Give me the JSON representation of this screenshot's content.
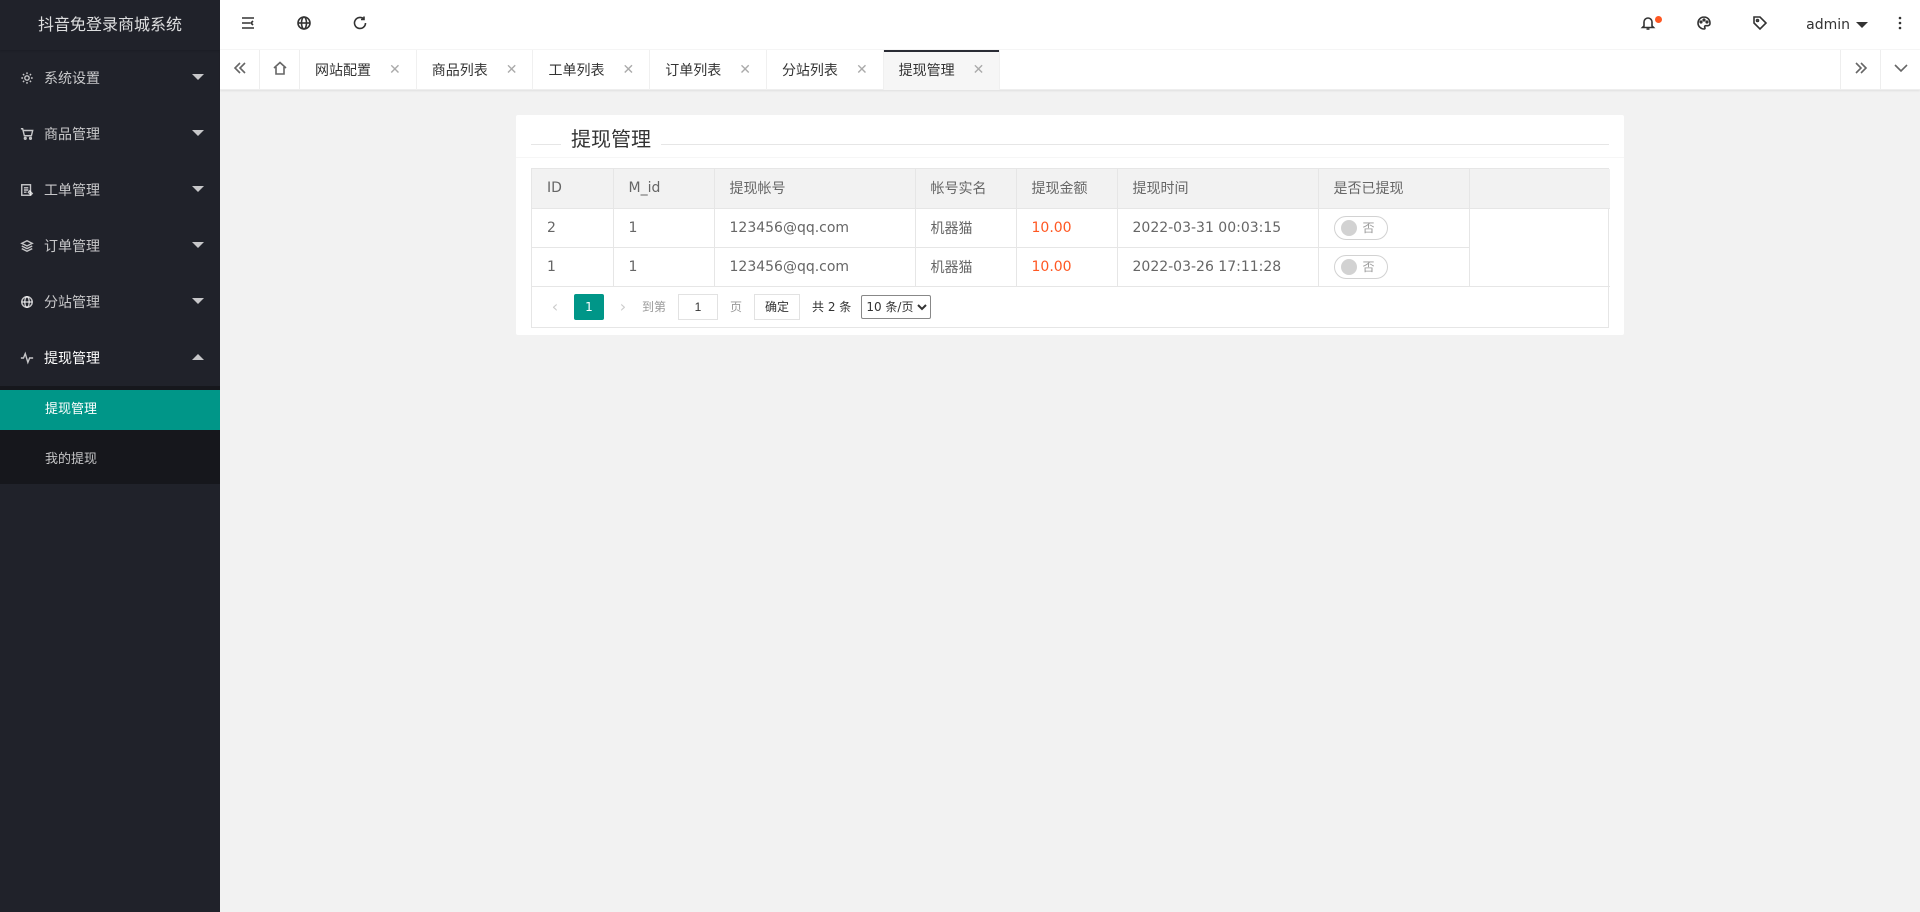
{
  "app": {
    "title": "抖音免登录商城系统"
  },
  "sidebar": {
    "items": [
      {
        "label": "系统设置",
        "icon": "gear-icon"
      },
      {
        "label": "商品管理",
        "icon": "cart-icon"
      },
      {
        "label": "工单管理",
        "icon": "ticket-icon"
      },
      {
        "label": "订单管理",
        "icon": "layers-icon"
      },
      {
        "label": "分站管理",
        "icon": "globe-icon"
      },
      {
        "label": "提现管理",
        "icon": "pulse-icon"
      }
    ],
    "subitems": [
      {
        "label": "提现管理"
      },
      {
        "label": "我的提现"
      }
    ]
  },
  "header": {
    "user": "admin",
    "icons": [
      "menu-fold-icon",
      "globe-icon",
      "refresh-icon",
      "bell-icon",
      "palette-icon",
      "tag-icon",
      "more-vertical-icon"
    ],
    "notification_color": "#ff5722"
  },
  "tabs": [
    {
      "label": "网站配置"
    },
    {
      "label": "商品列表"
    },
    {
      "label": "工单列表"
    },
    {
      "label": "订单列表"
    },
    {
      "label": "分站列表"
    },
    {
      "label": "提现管理"
    }
  ],
  "card": {
    "title": "提现管理",
    "columns": [
      "ID",
      "M_id",
      "提现帐号",
      "帐号实名",
      "提现金额",
      "提现时间",
      "是否已提现"
    ],
    "rows": [
      {
        "id": "2",
        "mid": "1",
        "account": "123456@qq.com",
        "name": "机器猫",
        "amount": "10.00",
        "time": "2022-03-31 00:03:15",
        "status": "否"
      },
      {
        "id": "1",
        "mid": "1",
        "account": "123456@qq.com",
        "name": "机器猫",
        "amount": "10.00",
        "time": "2022-03-26 17:11:28",
        "status": "否"
      }
    ]
  },
  "pager": {
    "current": "1",
    "goto_label": "到第",
    "goto_value": "1",
    "page_label": "页",
    "confirm": "确定",
    "total": "共 2 条",
    "page_size": "10 条/页"
  },
  "colors": {
    "accent": "#009688",
    "sidebar_bg": "#20222a",
    "amount": "#ff5722"
  }
}
